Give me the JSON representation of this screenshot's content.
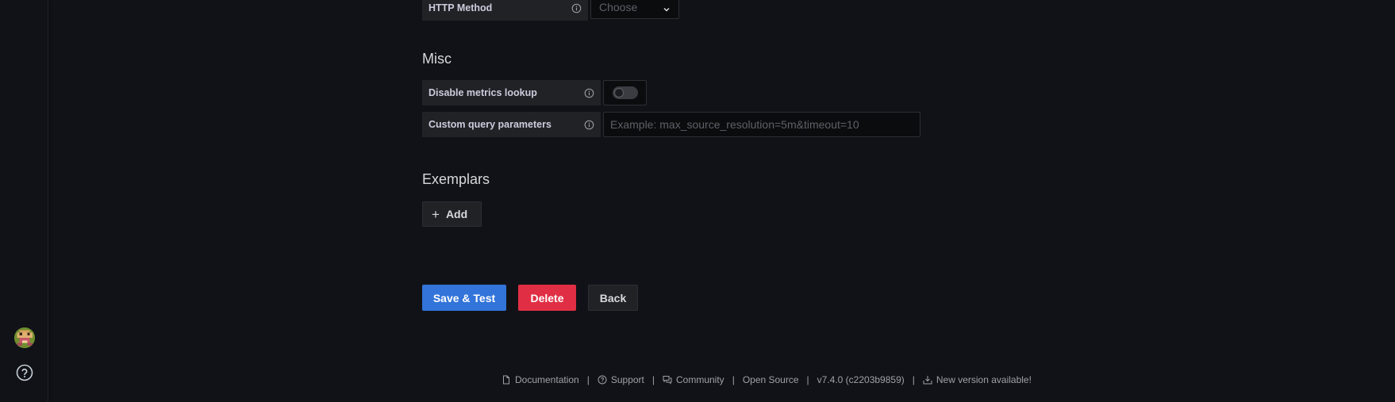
{
  "http_method": {
    "label": "HTTP Method",
    "placeholder": "Choose"
  },
  "misc": {
    "title": "Misc",
    "disable_metrics_lookup": {
      "label": "Disable metrics lookup",
      "enabled": false
    },
    "custom_query_parameters": {
      "label": "Custom query parameters",
      "placeholder": "Example: max_source_resolution=5m&timeout=10",
      "value": ""
    }
  },
  "exemplars": {
    "title": "Exemplars",
    "add_label": "Add"
  },
  "actions": {
    "save_test": "Save & Test",
    "delete": "Delete",
    "back": "Back"
  },
  "footer": {
    "documentation": "Documentation",
    "support": "Support",
    "community": "Community",
    "open_source": "Open Source",
    "version": "v7.4.0 (c2203b9859)",
    "new_version": "New version available!",
    "separator": "|"
  },
  "colors": {
    "background": "#111217",
    "primary": "#3274d9",
    "danger": "#e02f44",
    "panel": "#202226"
  },
  "icons": {
    "info": "info-circle-icon",
    "chevron": "chevron-down-icon",
    "plus": "plus-icon",
    "help": "question-circle-icon",
    "documentation": "document-icon",
    "support": "question-circle-icon",
    "community": "comments-icon",
    "new_version": "download-icon"
  }
}
